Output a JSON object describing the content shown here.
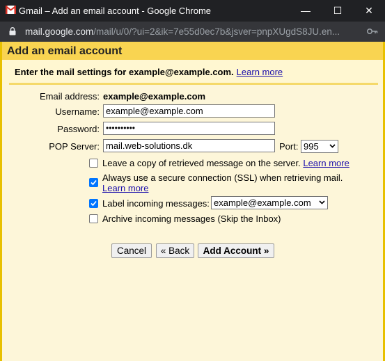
{
  "window": {
    "title": "Gmail – Add an email account - Google Chrome",
    "controls": {
      "minimize": "—",
      "maximize": "☐",
      "close": "✕"
    }
  },
  "address_bar": {
    "host": "mail.google.com",
    "path": "/mail/u/0/?ui=2&ik=7e55d0ec7b&jsver=pnpXUgdS8JU.en..."
  },
  "dialog": {
    "title": "Add an email account",
    "subheading": "Enter the mail settings for example@example.com.",
    "learn_more": "Learn more",
    "email_label": "Email address:",
    "email_value": "example@example.com",
    "username_label": "Username:",
    "username_value": "example@example.com",
    "password_label": "Password:",
    "password_value": "••••••••••",
    "pop_server_label": "POP Server:",
    "pop_server_value": "mail.web-solutions.dk",
    "port_label": "Port:",
    "port_value": "995",
    "options": {
      "leave_copy": {
        "label": "Leave a copy of retrieved message on the server.",
        "link": "Learn more",
        "checked": false
      },
      "ssl": {
        "label": "Always use a secure connection (SSL) when retrieving mail.",
        "link": "Learn more",
        "checked": true
      },
      "label_incoming": {
        "label": "Label incoming messages:",
        "select_value": "example@example.com",
        "checked": true
      },
      "archive": {
        "label": "Archive incoming messages (Skip the Inbox)",
        "checked": false
      }
    },
    "buttons": {
      "cancel": "Cancel",
      "back": "« Back",
      "add": "Add Account »"
    }
  },
  "colors": {
    "header": "#f9d451",
    "dialog_bg": "#fdf6d9",
    "checkbox_checked": "#0075ff",
    "link": "#1a0dab"
  }
}
